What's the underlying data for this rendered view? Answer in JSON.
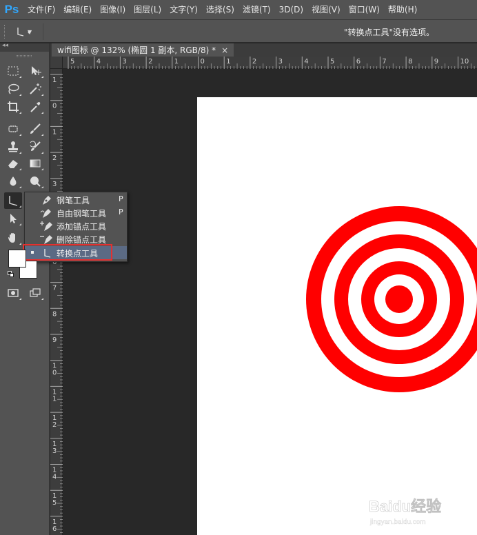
{
  "app": {
    "logo": "Ps"
  },
  "menu": [
    "文件(F)",
    "编辑(E)",
    "图像(I)",
    "图层(L)",
    "文字(Y)",
    "选择(S)",
    "滤镜(T)",
    "3D(D)",
    "视图(V)",
    "窗口(W)",
    "帮助(H)"
  ],
  "options_bar": {
    "hint": "\"转换点工具\"没有选项。"
  },
  "document_tab": {
    "title": "wifi图标 @ 132% (椭圆 1 副本, RGB/8) *",
    "close": "×"
  },
  "ruler_top_labels": [
    "5",
    "4",
    "3",
    "2",
    "1",
    "0",
    "1",
    "2",
    "3",
    "4",
    "5",
    "6",
    "7",
    "8",
    "9",
    "10"
  ],
  "ruler_left_labels": [
    "1",
    "0",
    "1",
    "2",
    "3",
    "4",
    "5",
    "6",
    "7",
    "8",
    "9",
    "10",
    "11",
    "12",
    "13",
    "14",
    "15",
    "16"
  ],
  "pen_flyout": [
    {
      "label": "钢笔工具",
      "key": "P",
      "icon": "pen-icon",
      "selected": false
    },
    {
      "label": "自由钢笔工具",
      "key": "P",
      "icon": "freeform-pen-icon",
      "selected": false
    },
    {
      "label": "添加锚点工具",
      "key": "",
      "icon": "add-anchor-icon",
      "selected": false
    },
    {
      "label": "删除锚点工具",
      "key": "",
      "icon": "delete-anchor-icon",
      "selected": false
    },
    {
      "label": "转换点工具",
      "key": "",
      "icon": "convert-point-icon",
      "selected": true
    }
  ],
  "colors": {
    "target_red": "#ff0000",
    "accent_highlight": "#e53030",
    "selection_row": "#5b6a84",
    "ps_blue": "#31a8ff"
  },
  "watermark": {
    "text": "Baidu经验",
    "sub": "jingyan.baidu.com"
  }
}
